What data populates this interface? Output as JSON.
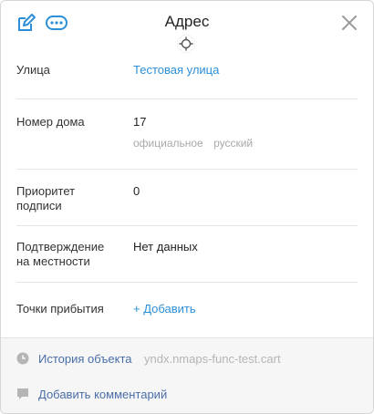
{
  "header": {
    "title": "Адрес",
    "icons": [
      "edit-icon",
      "more-icon",
      "close-icon"
    ]
  },
  "fields": {
    "street": {
      "label": "Улица",
      "value": "Тестовая улица"
    },
    "house": {
      "label": "Номер дома",
      "value": "17",
      "tags": [
        "официальное",
        "русский"
      ]
    },
    "priority": {
      "label": "Приоритет подписи",
      "value": "0"
    },
    "confirmation": {
      "label": "Подтверждение на местности",
      "value": "Нет данных"
    },
    "arrival": {
      "label": "Точки прибытия",
      "action": "+ Добавить"
    }
  },
  "footer": {
    "history_label": "История объекта",
    "history_meta": "yndx.nmaps-func-test.cart",
    "comment_label": "Добавить комментарий"
  },
  "colors": {
    "accent": "#2d8fd8",
    "link": "#4a6ea9",
    "muted": "#a9a9a9"
  }
}
